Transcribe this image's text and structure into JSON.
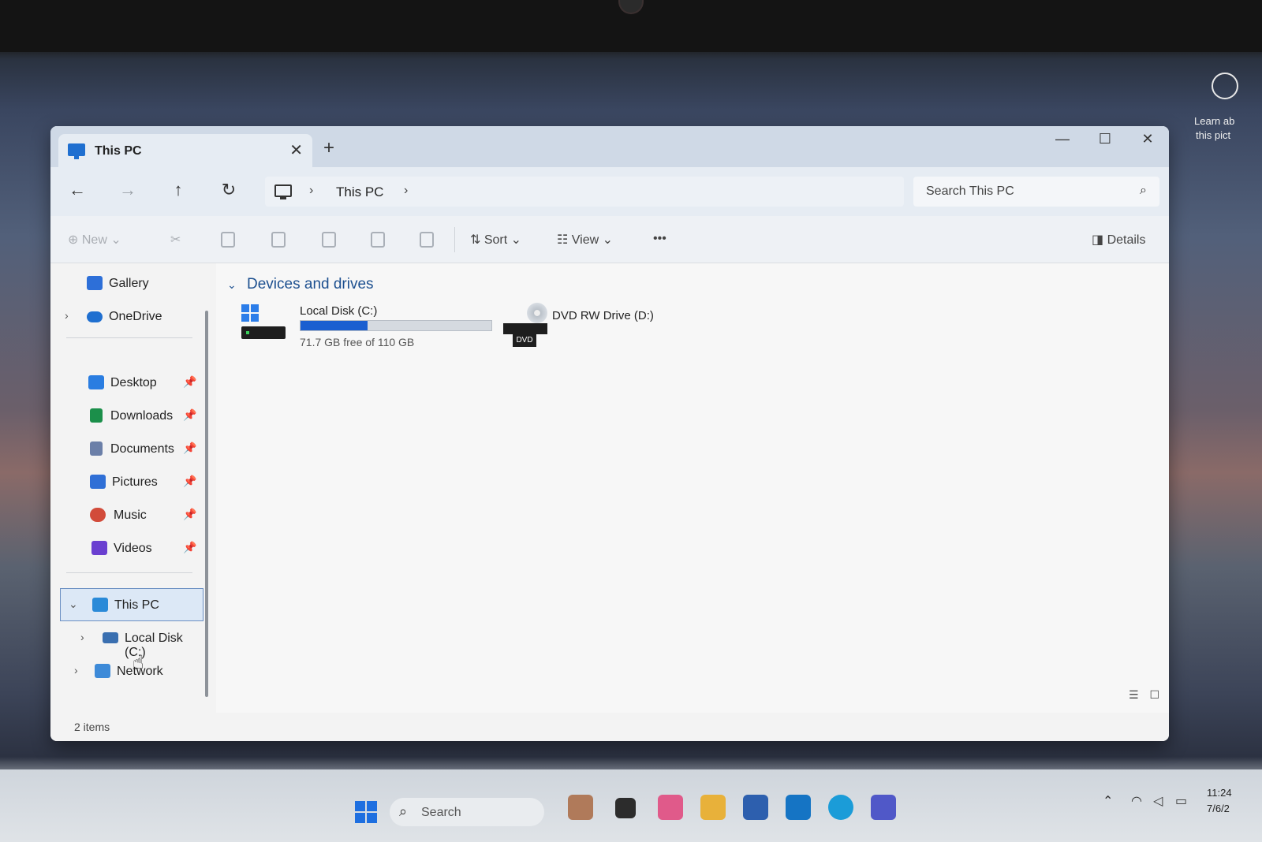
{
  "window": {
    "tab_title": "This PC",
    "tab_close": "✕",
    "new_tab": "+",
    "minimize": "—",
    "maximize": "☐",
    "close": "✕"
  },
  "address": {
    "back": "←",
    "forward": "→",
    "up": "↑",
    "refresh": "↻",
    "separator": "›",
    "breadcrumb": "This PC",
    "search_placeholder": "Search This PC",
    "search_icon": "⌕"
  },
  "toolbar": {
    "new_label": "New",
    "sort_label": "Sort",
    "view_label": "View",
    "more_label": "•••",
    "details_label": "Details"
  },
  "nav": {
    "top_items": [
      {
        "label": "Gallery",
        "icon": "gallery-icon"
      },
      {
        "label": "OneDrive",
        "icon": "onedrive-icon"
      }
    ],
    "quick_access": [
      {
        "label": "Desktop",
        "icon": "desktop-icon",
        "color": "#2a7de1"
      },
      {
        "label": "Downloads",
        "icon": "download-icon",
        "color": "#1b8f4a"
      },
      {
        "label": "Documents",
        "icon": "documents-icon",
        "color": "#6b7fa8"
      },
      {
        "label": "Pictures",
        "icon": "pictures-icon",
        "color": "#2f6fd6"
      },
      {
        "label": "Music",
        "icon": "music-icon",
        "color": "#d24b3a"
      },
      {
        "label": "Videos",
        "icon": "videos-icon",
        "color": "#6a3fd0"
      }
    ],
    "pin_glyph": "📌",
    "this_pc": "This PC",
    "local_disk": "Local Disk (C:)",
    "network": "Network"
  },
  "content": {
    "group_title": "Devices and drives",
    "drives": [
      {
        "name": "Local Disk (C:)",
        "free_text": "71.7 GB free of 110 GB",
        "used_fraction": 0.35
      },
      {
        "name": "DVD RW Drive (D:)",
        "dvd_label": "DVD"
      }
    ]
  },
  "status": {
    "items": "2 items"
  },
  "desktop": {
    "learn_line1": "Learn ab",
    "learn_line2": "this pict"
  },
  "taskbar": {
    "search_label": "Search",
    "clock_time": "11:24",
    "clock_date": "7/6/2"
  },
  "colors": {
    "accent": "#1a5fd0",
    "selection_bg": "#dce8f6",
    "group_header": "#1c4f8f"
  }
}
